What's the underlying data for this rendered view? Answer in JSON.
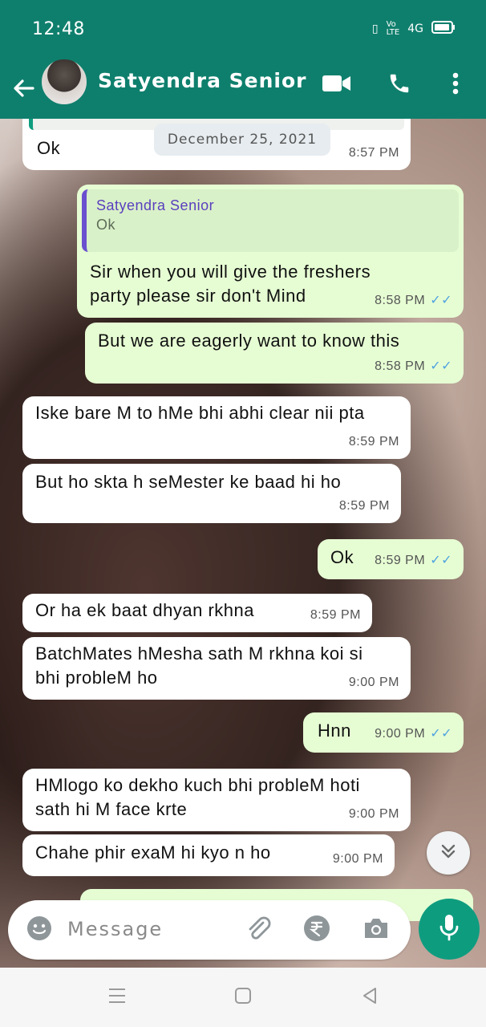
{
  "status": {
    "time": "12:48",
    "indicators": "4G"
  },
  "header": {
    "name": "Satyendra Senior"
  },
  "chat": {
    "date": "December 25, 2021",
    "messages": [
      {
        "dir": "in",
        "text": "Ok",
        "time": "8:57 PM"
      },
      {
        "dir": "out",
        "quote_name": "Satyendra Senior",
        "quote_text": "Ok",
        "text": "Sir when you will give the freshers party please sir don't Mind",
        "time": "8:58 PM"
      },
      {
        "dir": "out",
        "text": "But we are eagerly want to know this",
        "time": "8:58 PM"
      },
      {
        "dir": "in",
        "text": "Iske bare M to hMe bhi abhi clear nii pta",
        "time": "8:59 PM"
      },
      {
        "dir": "in",
        "text": "But ho skta h seMester ke baad hi ho",
        "time": "8:59 PM"
      },
      {
        "dir": "out",
        "text": "Ok",
        "time": "8:59 PM"
      },
      {
        "dir": "in",
        "text": "Or ha ek baat dhyan rkhna",
        "time": "8:59 PM"
      },
      {
        "dir": "in",
        "text": "BatchMates hMesha sath M rkhna koi si bhi probleM ho",
        "time": "9:00 PM"
      },
      {
        "dir": "out",
        "text": "Hnn",
        "time": "9:00 PM"
      },
      {
        "dir": "in",
        "text": "HMlogo ko dekho kuch bhi probleM hoti sath hi M face krte",
        "time": "9:00 PM"
      },
      {
        "dir": "in",
        "text": "Chahe phir exaM hi kyo n ho",
        "time": "9:00 PM"
      }
    ]
  },
  "input": {
    "placeholder": "Message"
  },
  "icons": {
    "back": "arrow-left",
    "video": "video-camera",
    "call": "phone",
    "menu": "more-vertical",
    "emoji": "smiley",
    "attach": "paperclip",
    "pay": "rupee",
    "camera": "camera",
    "mic": "microphone",
    "scroll": "double-chevron-down"
  },
  "colors": {
    "header": "#0f7f6d",
    "outgoing": "#e6fdd3",
    "incoming": "#ffffff",
    "accent": "#0e9c7f",
    "tick": "#4fa3e0"
  }
}
